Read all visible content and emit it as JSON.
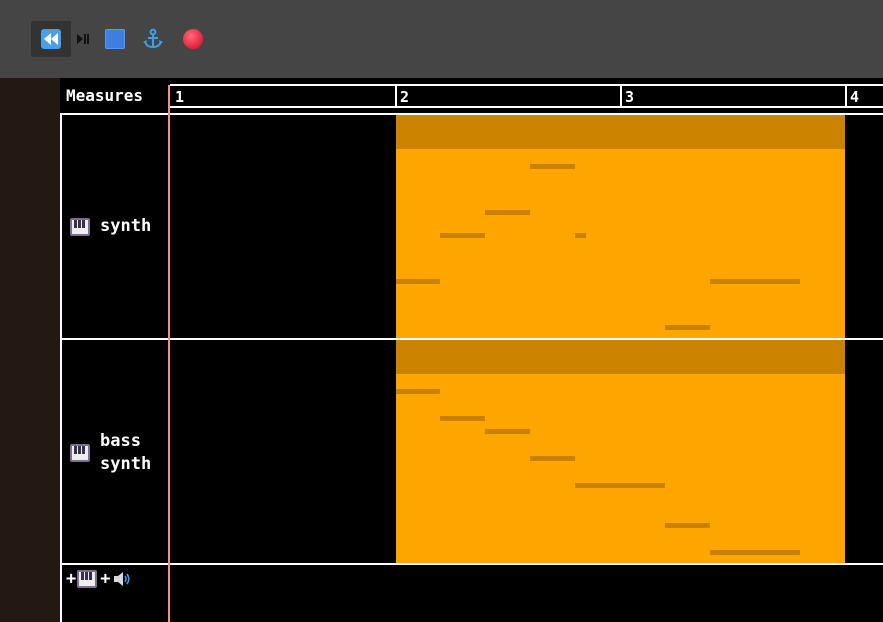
{
  "toolbar": {
    "buttons": [
      {
        "name": "rewind-button",
        "icon": "rewind-icon"
      },
      {
        "name": "play-pause-button",
        "icon": "play-pause-icon"
      },
      {
        "name": "stop-button",
        "icon": "stop-icon"
      },
      {
        "name": "anchor-button",
        "icon": "anchor-icon"
      },
      {
        "name": "record-button",
        "icon": "record-icon"
      }
    ]
  },
  "timeline": {
    "label": "Measures",
    "measures": [
      "1",
      "2",
      "3",
      "4"
    ]
  },
  "tracks": [
    {
      "name": "synth",
      "icon": "piano-icon"
    },
    {
      "name_line1": "bass",
      "name_line2": "synth",
      "icon": "piano-icon"
    }
  ],
  "add_controls": {
    "add_instrument_label": "+",
    "add_audio_label": "+",
    "instrument_icon": "piano-icon",
    "audio_icon": "speaker-icon"
  },
  "colors": {
    "clip": "#ffa500",
    "clip_header": "#cc8400",
    "note": "#c98200",
    "playhead": "#f4908a",
    "toolbar_bg": "#454545"
  }
}
